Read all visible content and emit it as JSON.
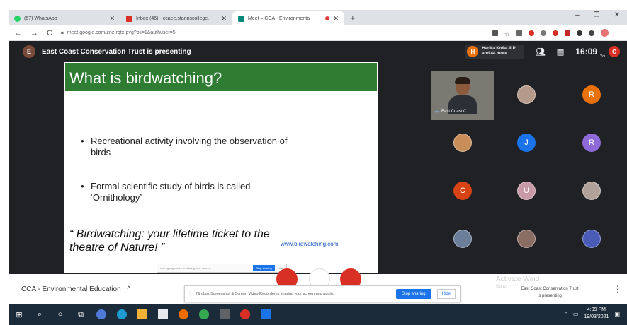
{
  "browser": {
    "tabs": [
      {
        "title": "(67) WhatsApp",
        "color": "#25d366",
        "active": false
      },
      {
        "title": "Inbox (46) - ccaee.stannscollege.",
        "color": "#d93025",
        "active": false
      },
      {
        "title": "Meet – CCA - Environmenta",
        "color": "#00897b",
        "active": true
      }
    ],
    "new_tab": "+",
    "window_controls": [
      "–",
      "❐",
      "✕"
    ],
    "url": "meet.google.com/znz-rqtx-pvg?pli=1&authuser=5"
  },
  "meet": {
    "presenter_avatar": "E",
    "presenter_text": "East Coast Conservation Trust is presenting",
    "participants_chip": {
      "avatar": "H",
      "line1": "Harika Kolla JLP...",
      "line2": "and 44 more"
    },
    "participant_count_icon": "people-icon",
    "clock": "16:09",
    "self": {
      "avatar": "C",
      "label": "You"
    }
  },
  "slide": {
    "title": "What is birdwatching?",
    "bullet1_line1": "Recreational activity involving the observation of",
    "bullet1_line2": "birds",
    "bullet2_line1": "Formal scientific study of birds is called",
    "bullet2_line2": "‘Ornithology’",
    "quote_line1": "“ Birdwatching: your lifetime ticket to the",
    "quote_line2": "theatre of Nature! ”",
    "link": "www.birdwatching.com",
    "mini_share_text": "meet.google.com is sharing your screen.",
    "mini_stop": "Stop sharing",
    "mini_hide": "Hide"
  },
  "grid": {
    "cam_name": "East Coast C...",
    "tiles": [
      {
        "letter": "",
        "color": "#b59a8a",
        "kind": "img"
      },
      {
        "letter": "R",
        "color": "#e8710a",
        "kind": "letter"
      },
      {
        "letter": "",
        "color": "#c98d5a",
        "kind": "img"
      },
      {
        "letter": "J",
        "color": "#1a73e8",
        "kind": "letter"
      },
      {
        "letter": "R",
        "color": "#8e6ad8",
        "kind": "letter"
      },
      {
        "letter": "C",
        "color": "#d84315",
        "kind": "letter"
      },
      {
        "letter": "U",
        "color": "#c89aa8",
        "kind": "img"
      },
      {
        "letter": "",
        "color": "#b0a29a",
        "kind": "img"
      },
      {
        "letter": "",
        "color": "#6b7f9a",
        "kind": "img"
      },
      {
        "letter": "",
        "color": "#8a6d63",
        "kind": "img"
      },
      {
        "letter": "",
        "color": "#4a5bb5",
        "kind": "img"
      }
    ]
  },
  "bottom": {
    "meeting_name": "CCA - Environmental Education",
    "share_text": "Nimbus Screenshot & Screen Video Recorder is sharing your screen and audio.",
    "stop_sharing": "Stop sharing",
    "hide": "Hide",
    "activate": "Activate Wind",
    "activate_sub": "Go to",
    "presenting_line1": "East Coast Conservation Trust",
    "presenting_line2": "is presenting"
  },
  "taskbar": {
    "time": "4:09 PM",
    "date": "19/03/2021"
  }
}
